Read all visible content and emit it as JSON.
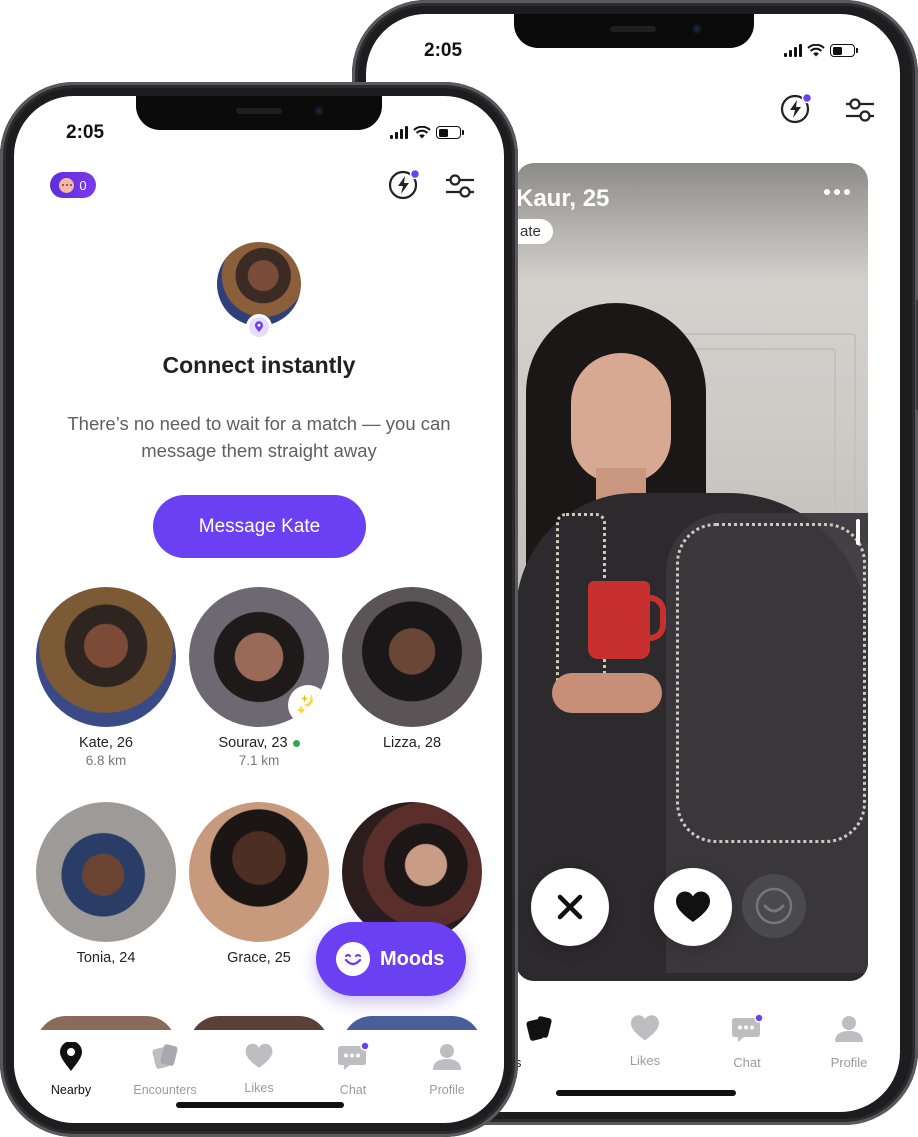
{
  "status_bar": {
    "time": "2:05"
  },
  "back_screen": {
    "card": {
      "name": "Kaur, 25",
      "pill": "ate"
    },
    "tabs": [
      "Encounters",
      "Likes",
      "Chat",
      "Profile"
    ],
    "tab_labels_shown": [
      "ounters",
      "Likes",
      "Chat",
      "Profile"
    ]
  },
  "front_screen": {
    "counter": "0",
    "headline": "Connect instantly",
    "subtext": "There’s no need to wait for a match — you can message them straight away",
    "cta_label": "Message Kate",
    "people": [
      {
        "name": "Kate, 26",
        "distance": "6.8 km"
      },
      {
        "name": "Sourav, 23",
        "distance": "7.1 km",
        "online": true,
        "badge": "sparkle"
      },
      {
        "name": "Lizza, 28"
      },
      {
        "name": "Tonia, 24"
      },
      {
        "name": "Grace, 25"
      }
    ],
    "moods_label": "Moods",
    "tabs": [
      "Nearby",
      "Encounters",
      "Likes",
      "Chat",
      "Profile"
    ],
    "active_tab": "Nearby"
  },
  "colors": {
    "accent": "#6b3ff2",
    "online": "#2fa84f",
    "text": "#222222",
    "muted": "#9b9b9f"
  }
}
